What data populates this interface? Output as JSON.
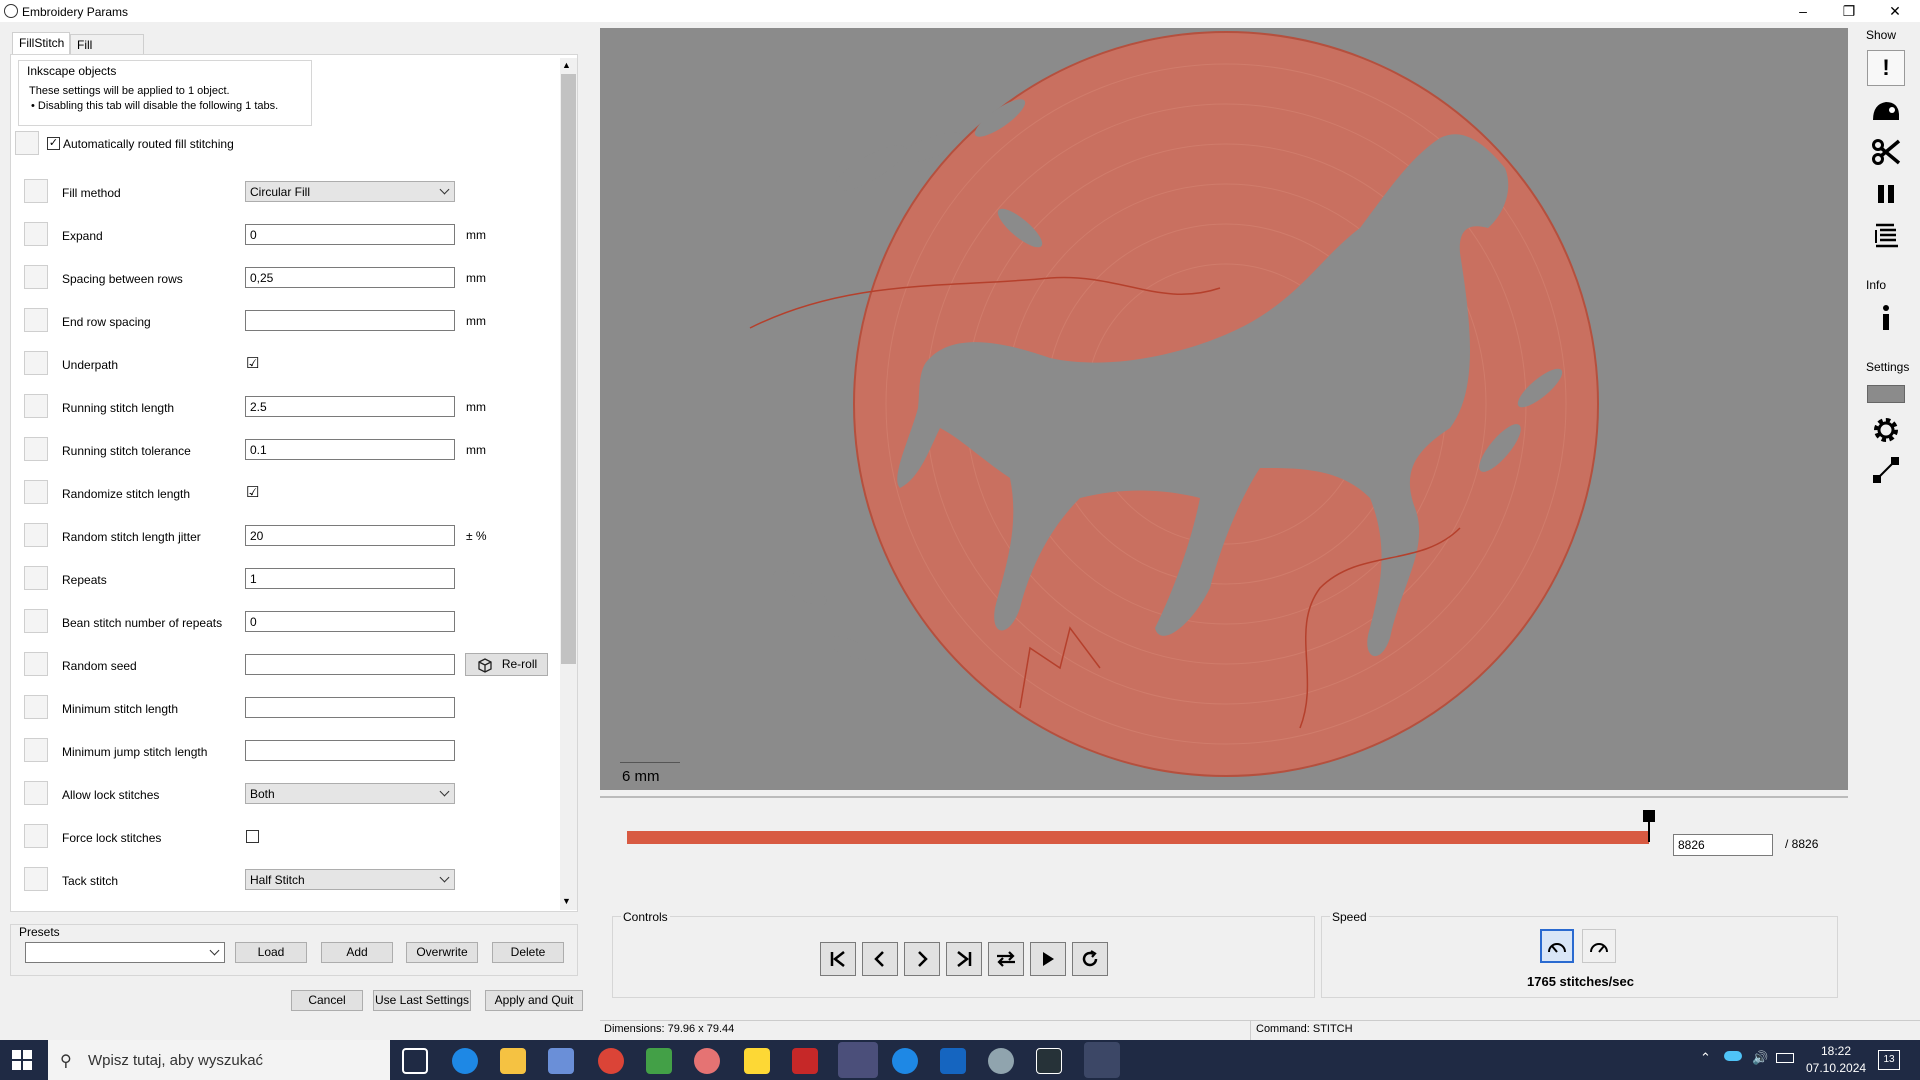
{
  "window": {
    "title": "Embroidery Params"
  },
  "tabs": [
    {
      "label": "FillStitch"
    },
    {
      "label": "Fill Underlay"
    }
  ],
  "inkscape_objects": {
    "title": "Inkscape objects",
    "line1": "These settings will be applied to 1 object.",
    "line2": "• Disabling this tab will disable the following 1 tabs."
  },
  "auto_route": {
    "label": "Automatically routed fill stitching",
    "checked": true
  },
  "params": [
    {
      "label": "Fill method",
      "type": "select",
      "value": "Circular Fill",
      "unit": ""
    },
    {
      "label": "Expand",
      "type": "text",
      "value": "0",
      "unit": "mm"
    },
    {
      "label": "Spacing between rows",
      "type": "text",
      "value": "0,25",
      "unit": "mm"
    },
    {
      "label": "End row spacing",
      "type": "text",
      "value": "",
      "unit": "mm"
    },
    {
      "label": "Underpath",
      "type": "checkbox",
      "value": "☑",
      "unit": ""
    },
    {
      "label": "Running stitch length",
      "type": "text",
      "value": "2.5",
      "unit": "mm"
    },
    {
      "label": "Running stitch tolerance",
      "type": "text",
      "value": "0.1",
      "unit": "mm"
    },
    {
      "label": "Randomize stitch length",
      "type": "checkbox",
      "value": "☑",
      "unit": ""
    },
    {
      "label": "Random stitch length jitter",
      "type": "text",
      "value": "20",
      "unit": "± %"
    },
    {
      "label": "Repeats",
      "type": "text",
      "value": "1",
      "unit": ""
    },
    {
      "label": "Bean stitch number of repeats",
      "type": "text",
      "value": "0",
      "unit": ""
    },
    {
      "label": "Random seed",
      "type": "text",
      "value": "",
      "unit": ""
    },
    {
      "label": "Minimum stitch length",
      "type": "text",
      "value": "",
      "unit": ""
    },
    {
      "label": "Minimum jump stitch length",
      "type": "text",
      "value": "",
      "unit": ""
    },
    {
      "label": "Allow lock stitches",
      "type": "select",
      "value": "Both",
      "unit": ""
    },
    {
      "label": "Force lock stitches",
      "type": "checkbox",
      "value": "",
      "unit": ""
    },
    {
      "label": "Tack stitch",
      "type": "select",
      "value": "Half Stitch",
      "unit": ""
    }
  ],
  "reroll_label": "Re-roll",
  "presets": {
    "title": "Presets",
    "load": "Load",
    "add": "Add",
    "overwrite": "Overwrite",
    "delete": "Delete"
  },
  "footer": {
    "cancel": "Cancel",
    "use_last": "Use Last Settings",
    "apply": "Apply and Quit"
  },
  "preview": {
    "scale_label": "6 mm",
    "stitch_color": "#d85a42",
    "background": "#8b8b8b"
  },
  "slider": {
    "current": "8826",
    "total": "/ 8826",
    "progress": 1.0
  },
  "controls": {
    "title": "Controls"
  },
  "speed": {
    "title": "Speed",
    "value": "1765 stitches/sec"
  },
  "rightbar": {
    "show_label": "Show",
    "info_label": "Info",
    "settings_label": "Settings",
    "show_icons": [
      "warning-icon",
      "needle-icon",
      "trim-icon",
      "pause-icon",
      "command-icon"
    ]
  },
  "status": {
    "dimensions": "Dimensions: 79.96 x 79.44",
    "command": "Command: STITCH"
  },
  "taskbar": {
    "search_placeholder": "Wpisz tutaj, aby wyszukać",
    "time": "18:22",
    "date": "07.10.2024",
    "notifications": "13"
  }
}
